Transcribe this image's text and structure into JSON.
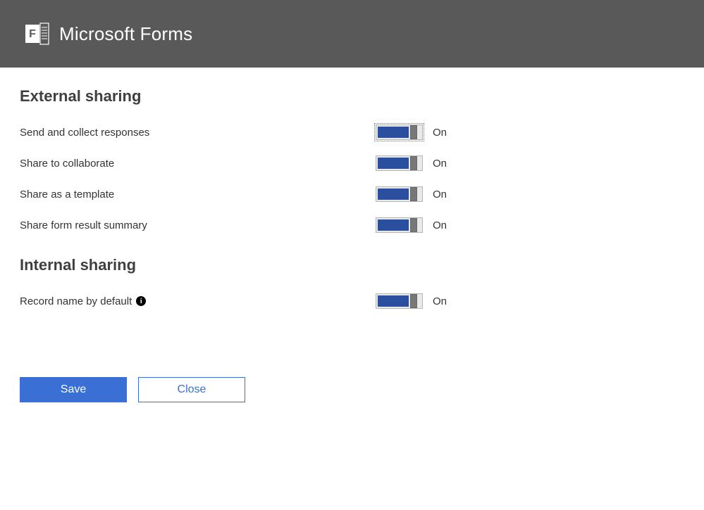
{
  "header": {
    "title": "Microsoft Forms"
  },
  "sections": {
    "external": {
      "title": "External sharing",
      "items": [
        {
          "label": "Send and collect responses",
          "state": "On",
          "focused": true
        },
        {
          "label": "Share to collaborate",
          "state": "On",
          "focused": false
        },
        {
          "label": "Share as a template",
          "state": "On",
          "focused": false
        },
        {
          "label": "Share form result summary",
          "state": "On",
          "focused": false
        }
      ]
    },
    "internal": {
      "title": "Internal sharing",
      "items": [
        {
          "label": "Record name by default",
          "state": "On",
          "has_info": true
        }
      ]
    }
  },
  "buttons": {
    "save": "Save",
    "close": "Close"
  },
  "colors": {
    "header_bg": "#595959",
    "accent": "#2a4f9e",
    "button_primary": "#3a70d6"
  }
}
